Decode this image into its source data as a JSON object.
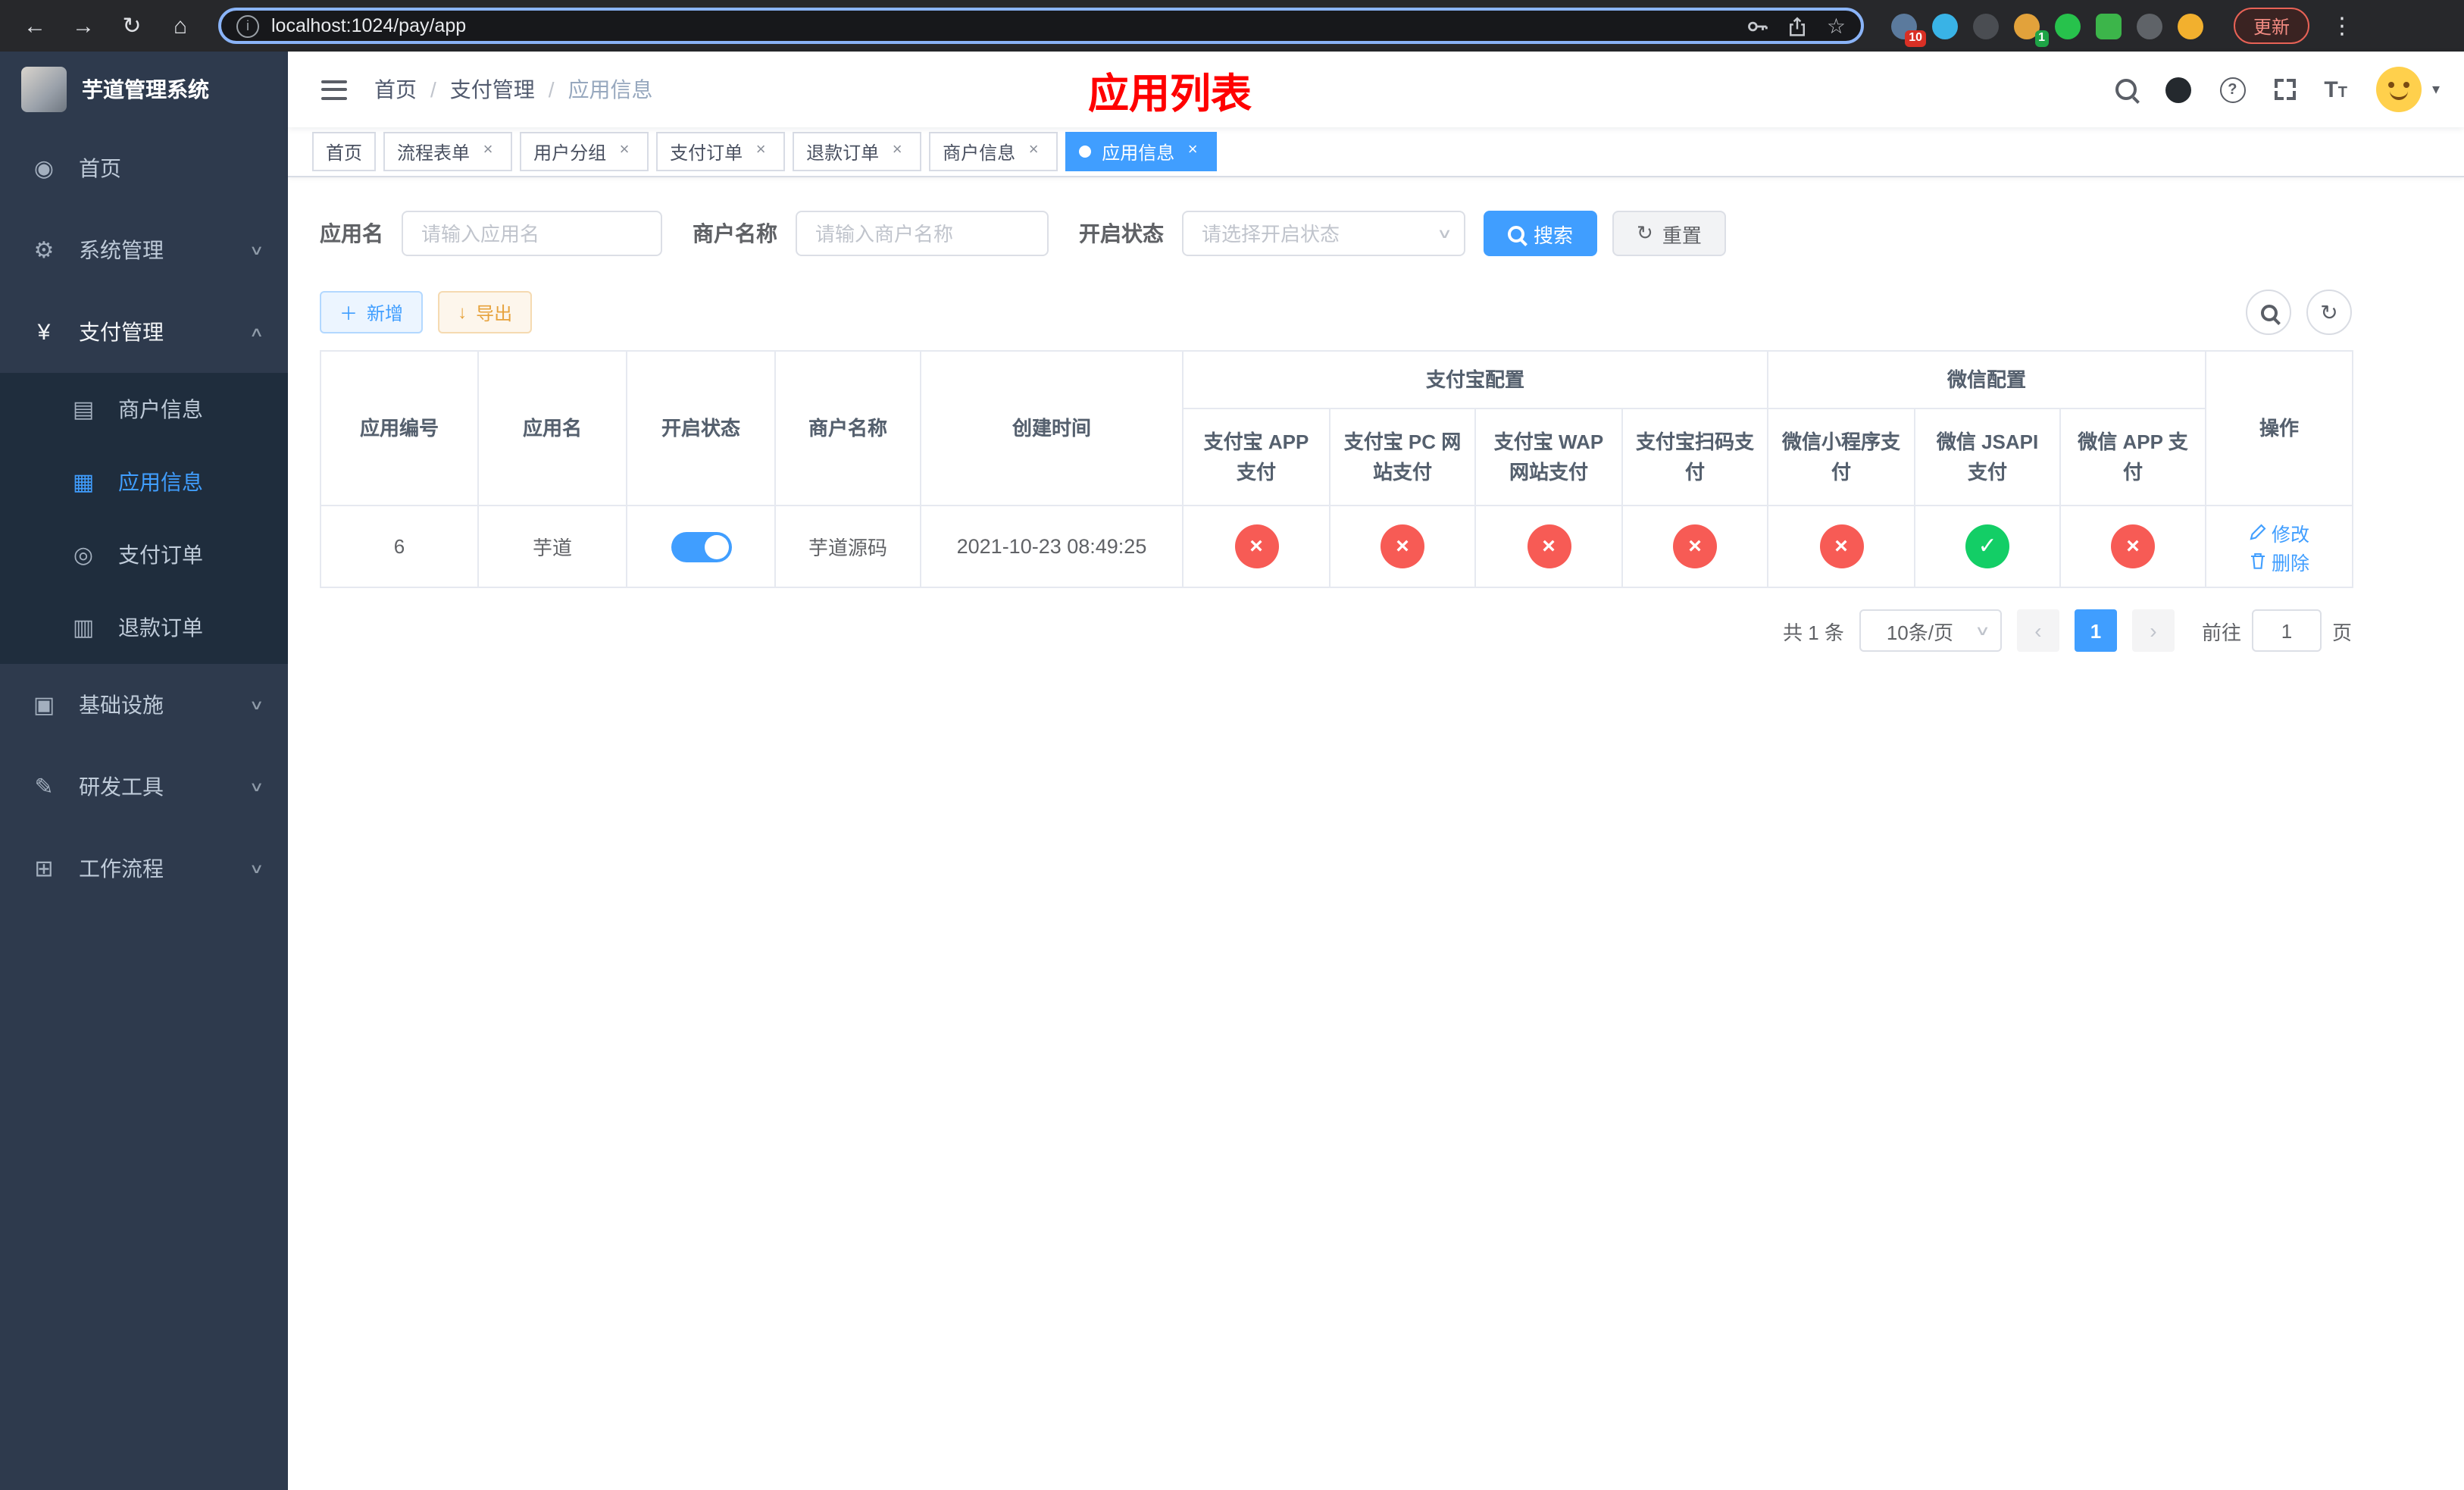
{
  "browser": {
    "url": "localhost:1024/pay/app",
    "update_label": "更新",
    "ext_badge_count": "10",
    "ext_badge_avatar": "1"
  },
  "sidebar": {
    "title": "芋道管理系统",
    "items": [
      {
        "label": "首页"
      },
      {
        "label": "系统管理"
      },
      {
        "label": "支付管理",
        "children": [
          {
            "label": "商户信息"
          },
          {
            "label": "应用信息"
          },
          {
            "label": "支付订单"
          },
          {
            "label": "退款订单"
          }
        ]
      },
      {
        "label": "基础设施"
      },
      {
        "label": "研发工具"
      },
      {
        "label": "工作流程"
      }
    ]
  },
  "header": {
    "breadcrumb": [
      "首页",
      "支付管理",
      "应用信息"
    ],
    "page_title": "应用列表"
  },
  "tabs": [
    {
      "label": "首页"
    },
    {
      "label": "流程表单"
    },
    {
      "label": "用户分组"
    },
    {
      "label": "支付订单"
    },
    {
      "label": "退款订单"
    },
    {
      "label": "商户信息"
    },
    {
      "label": "应用信息"
    }
  ],
  "filters": {
    "app_name_label": "应用名",
    "app_name_placeholder": "请输入应用名",
    "merchant_label": "商户名称",
    "merchant_placeholder": "请输入商户名称",
    "status_label": "开启状态",
    "status_placeholder": "请选择开启状态",
    "search_label": "搜索",
    "reset_label": "重置"
  },
  "toolbar": {
    "add_label": "新增",
    "export_label": "导出"
  },
  "table": {
    "columns": {
      "app_id": "应用编号",
      "app_name": "应用名",
      "status": "开启状态",
      "merchant": "商户名称",
      "created": "创建时间",
      "group_alipay": "支付宝配置",
      "group_wechat": "微信配置",
      "alipay_app": "支付宝 APP 支付",
      "alipay_pc": "支付宝 PC 网站支付",
      "alipay_wap": "支付宝 WAP 网站支付",
      "alipay_qr": "支付宝扫码支付",
      "wx_mini": "微信小程序支付",
      "wx_jsapi": "微信 JSAPI 支付",
      "wx_app": "微信 APP 支付",
      "actions": "操作"
    },
    "rows": [
      {
        "id": "6",
        "name": "芋道",
        "status": "on",
        "merchant": "芋道源码",
        "created": "2021-10-23 08:49:25",
        "alipay_app": "fail",
        "alipay_pc": "fail",
        "alipay_wap": "fail",
        "alipay_qr": "fail",
        "wx_mini": "fail",
        "wx_jsapi": "success",
        "wx_app": "fail",
        "edit_label": "修改",
        "delete_label": "删除"
      }
    ]
  },
  "pagination": {
    "total": "共 1 条",
    "page_size": "10条/页",
    "page": "1",
    "goto_label": "前往",
    "goto_value": "1",
    "page_unit": "页"
  },
  "colors": {
    "accent": "#409eff",
    "danger": "#f75b55",
    "success": "#13ce66",
    "title_red": "#ff0000",
    "sidebar_bg": "#2e3a4d",
    "submenu_bg": "#1f2d3d"
  }
}
